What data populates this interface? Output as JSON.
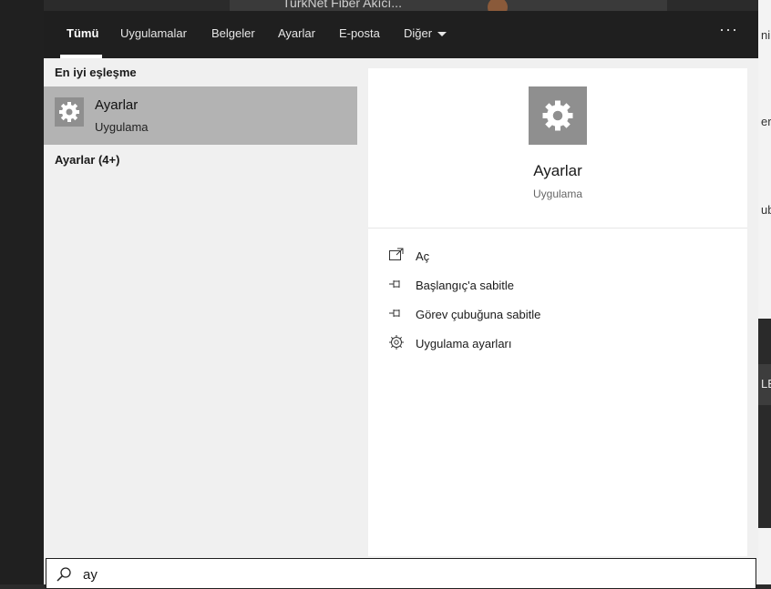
{
  "background": {
    "top_window_title": "TurkNet Fiber Akıcı...",
    "right_snippets": [
      "ni",
      "eri",
      "ub",
      "LE"
    ]
  },
  "tabs": [
    {
      "label": "Tümü",
      "active": true
    },
    {
      "label": "Uygulamalar"
    },
    {
      "label": "Belgeler"
    },
    {
      "label": "Ayarlar"
    },
    {
      "label": "E-posta"
    },
    {
      "label": "Diğer",
      "has_dropdown": true
    }
  ],
  "more_label": "···",
  "best_match": {
    "heading": "En iyi eşleşme",
    "title": "Ayarlar",
    "subtitle": "Uygulama",
    "icon": "gear-icon"
  },
  "settings_group": {
    "label": "Ayarlar (4+)"
  },
  "detail": {
    "title": "Ayarlar",
    "subtitle": "Uygulama",
    "actions": [
      {
        "label": "Aç",
        "icon": "open-icon"
      },
      {
        "label": "Başlangıç'a sabitle",
        "icon": "pin-icon"
      },
      {
        "label": "Görev çubuğuna sabitle",
        "icon": "pin-icon"
      },
      {
        "label": "Uygulama ayarları",
        "icon": "gear-icon"
      }
    ]
  },
  "search": {
    "value": "ay"
  },
  "colors": {
    "tab_bar": "#1f1f1f",
    "selected_result": "#b3b3b3",
    "panel": "#ffffff"
  }
}
